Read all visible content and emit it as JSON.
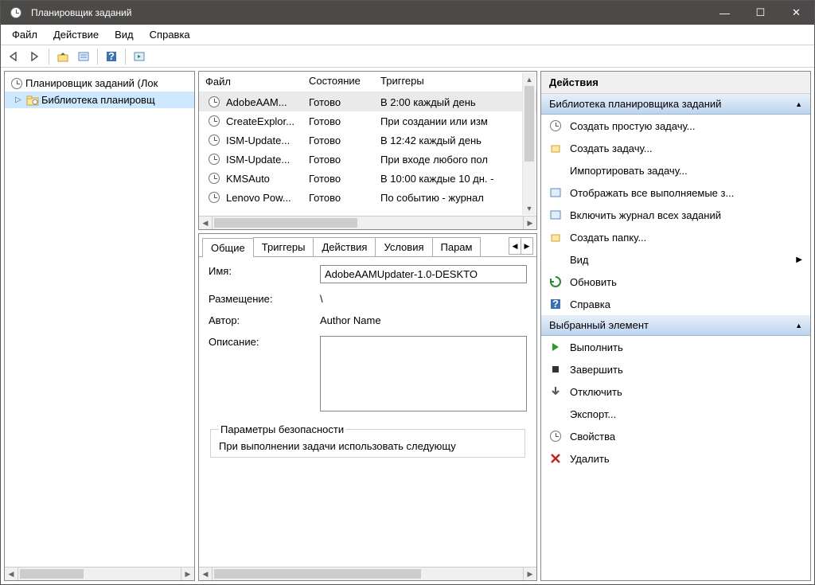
{
  "window": {
    "title": "Планировщик заданий"
  },
  "menu": {
    "file": "Файл",
    "action": "Действие",
    "view": "Вид",
    "help": "Справка"
  },
  "tree": {
    "root": "Планировщик заданий (Лок",
    "lib": "Библиотека планировщ"
  },
  "cols": {
    "file": "Файл",
    "state": "Состояние",
    "triggers": "Триггеры"
  },
  "tasks": [
    {
      "name": "AdobeAAM...",
      "state": "Готово",
      "trigger": "В 2:00 каждый день"
    },
    {
      "name": "CreateExplor...",
      "state": "Готово",
      "trigger": "При создании или изм"
    },
    {
      "name": "ISM-Update...",
      "state": "Готово",
      "trigger": "В 12:42 каждый день"
    },
    {
      "name": "ISM-Update...",
      "state": "Готово",
      "trigger": "При входе любого пол"
    },
    {
      "name": "KMSAuto",
      "state": "Готово",
      "trigger": "В 10:00 каждые 10 дн. - "
    },
    {
      "name": "Lenovo Pow...",
      "state": "Готово",
      "trigger": "По событию - журнал"
    }
  ],
  "tabs": {
    "general": "Общие",
    "triggers": "Триггеры",
    "actions": "Действия",
    "conditions": "Условия",
    "params": "Парам"
  },
  "details": {
    "name_label": "Имя:",
    "name_value": "AdobeAAMUpdater-1.0-DESKTO",
    "location_label": "Размещение:",
    "location_value": "\\",
    "author_label": "Автор:",
    "author_value": "Author Name",
    "description_label": "Описание:",
    "security_legend": "Параметры безопасности",
    "security_text": "При выполнении задачи использовать следующу"
  },
  "actions": {
    "header": "Действия",
    "section1": "Библиотека планировщика заданий",
    "items1": [
      "Создать простую задачу...",
      "Создать задачу...",
      "Импортировать задачу...",
      "Отображать все выполняемые з...",
      "Включить журнал всех заданий",
      "Создать папку...",
      "Вид",
      "Обновить",
      "Справка"
    ],
    "section2": "Выбранный элемент",
    "items2": [
      "Выполнить",
      "Завершить",
      "Отключить",
      "Экспорт...",
      "Свойства",
      "Удалить"
    ]
  }
}
